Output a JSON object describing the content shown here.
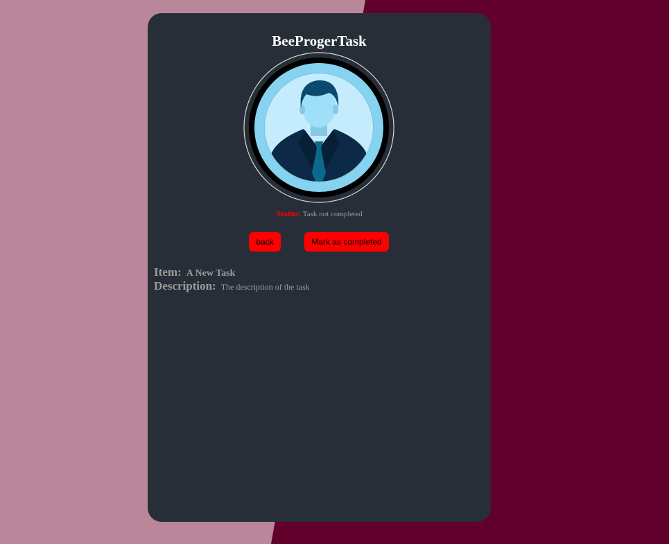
{
  "app": {
    "title": "BeeProgerTask"
  },
  "avatar": {
    "icon": "user-avatar-icon"
  },
  "status": {
    "label": "Status:",
    "value": "Task not completed"
  },
  "actions": {
    "back_label": "back",
    "complete_label": "Mark as completed"
  },
  "task": {
    "item_label": "Item:",
    "item_value": "A New Task",
    "description_label": "Description:",
    "description_value": "The description of the task"
  },
  "colors": {
    "background_left": "#b9869a",
    "background_right": "#62002c",
    "card": "#282e38",
    "accent": "#ff0000",
    "muted_text": "#9a9a9a"
  }
}
